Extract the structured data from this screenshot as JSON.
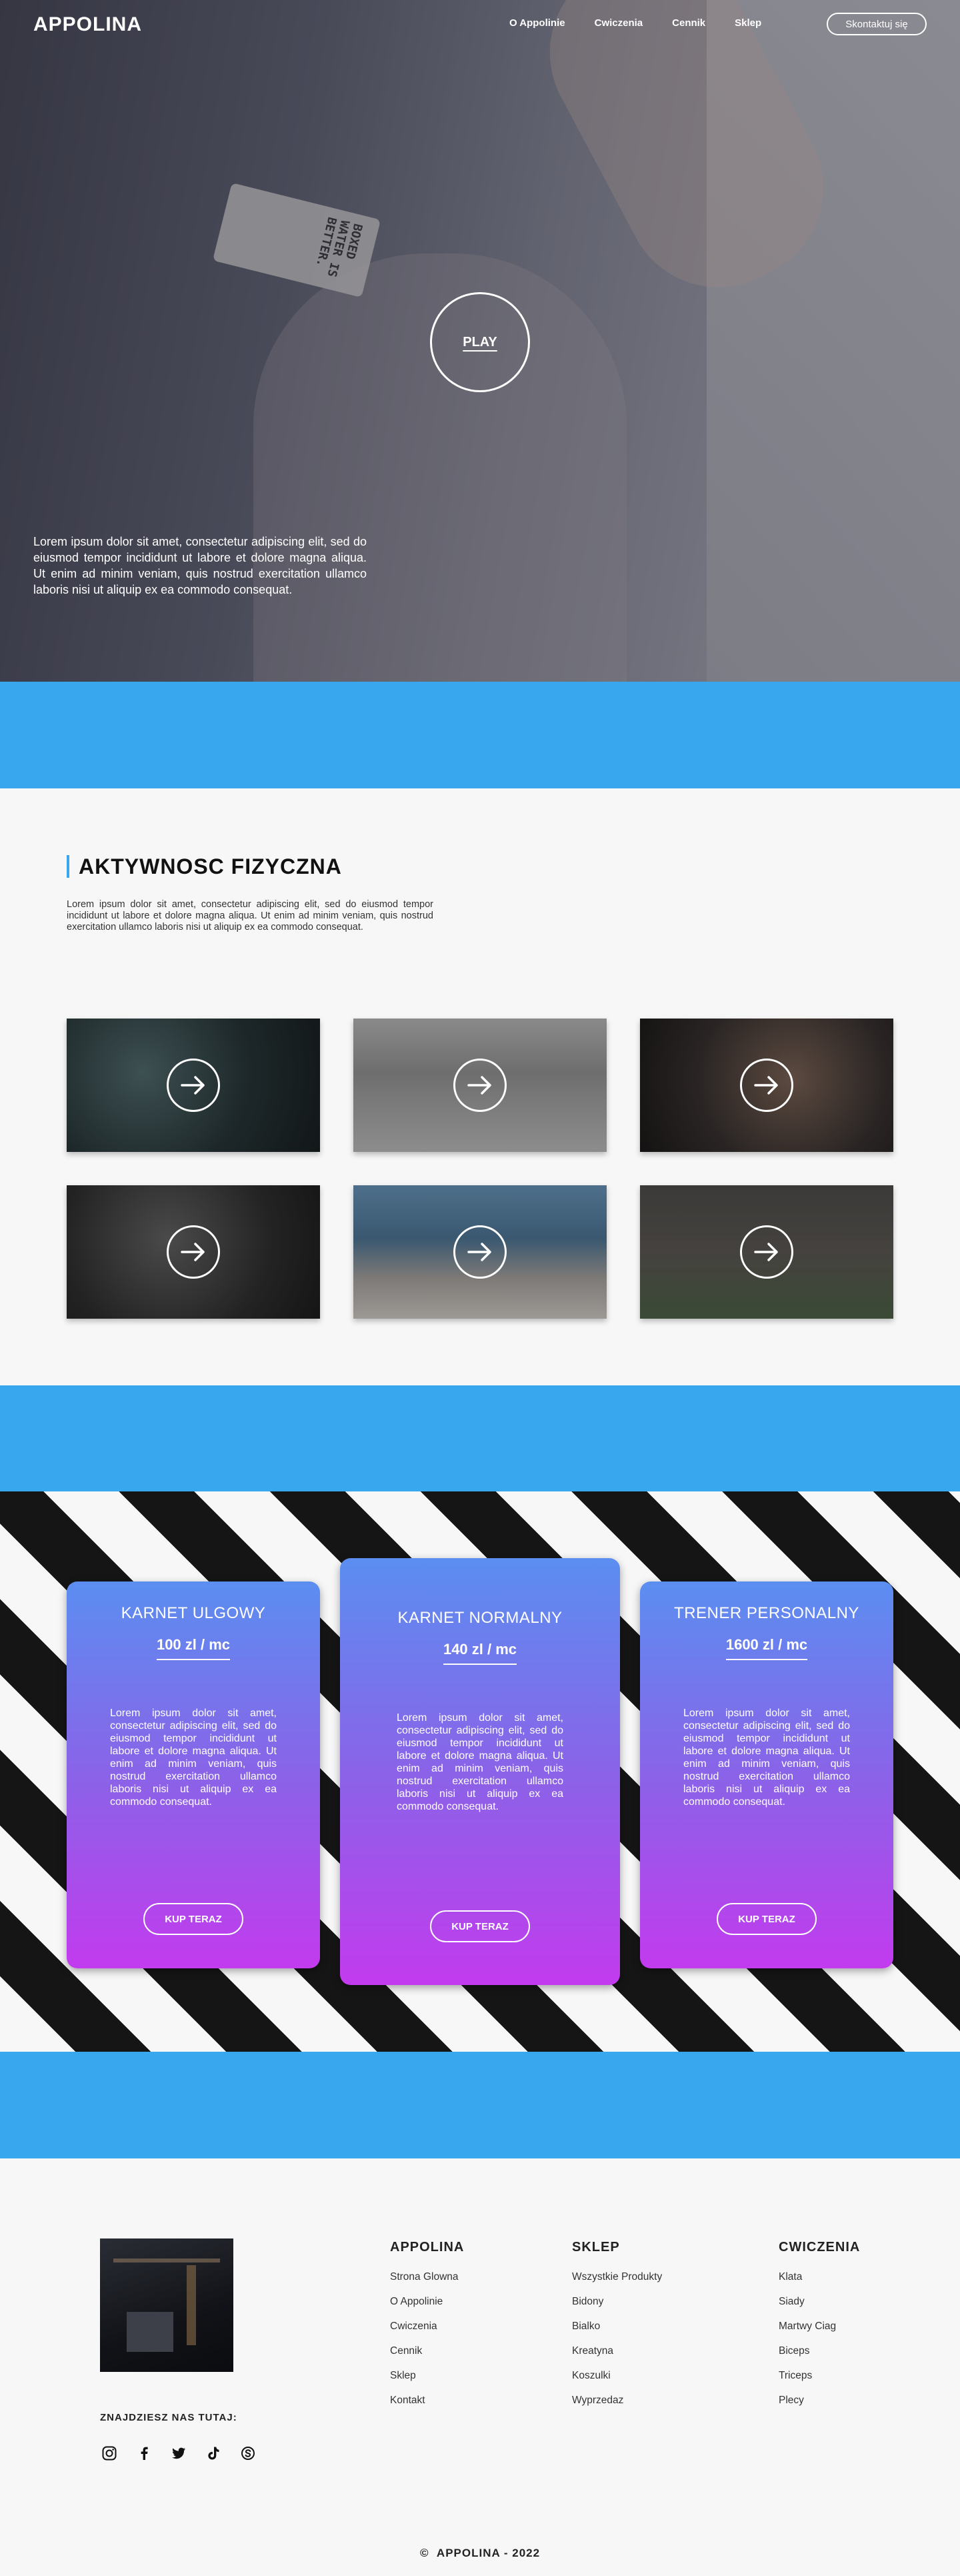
{
  "header": {
    "logo": "APPOLINA",
    "nav": [
      "O Appolinie",
      "Cwiczenia",
      "Cennik",
      "Sklep"
    ],
    "contact_label": "Skontaktuj się"
  },
  "hero": {
    "carton_text": "BOXED WATER IS BETTER.",
    "play_label": "PLAY",
    "text": "Lorem ipsum dolor sit amet, consectetur adipiscing elit, sed do eiusmod tempor incididunt ut labore et dolore magna aliqua. Ut enim ad minim veniam, quis nostrud exercitation ullamco laboris nisi ut aliquip ex ea commodo consequat."
  },
  "activity": {
    "title": "AKTYWNOSC FIZYCZNA",
    "text": "Lorem ipsum dolor sit amet, consectetur adipiscing elit, sed do eiusmod tempor incididunt ut labore et dolore magna aliqua. Ut enim ad minim veniam, quis nostrud exercitation ullamco laboris nisi ut aliquip ex ea commodo consequat.",
    "tiles": [
      {
        "icon": "arrow-right-icon"
      },
      {
        "icon": "arrow-right-icon"
      },
      {
        "icon": "arrow-right-icon"
      },
      {
        "icon": "arrow-right-icon"
      },
      {
        "icon": "arrow-right-icon"
      },
      {
        "icon": "arrow-right-icon"
      }
    ]
  },
  "pricing": {
    "cards": [
      {
        "title": "KARNET ULGOWY",
        "price": "100 zl / mc",
        "text": "Lorem ipsum dolor sit amet, consectetur adipiscing elit, sed do eiusmod tempor incididunt ut labore et dolore magna aliqua. Ut enim ad minim veniam, quis nostrud exercitation ullamco laboris nisi ut aliquip ex ea commodo consequat.",
        "button": "KUP TERAZ"
      },
      {
        "title": "KARNET NORMALNY",
        "price": "140 zl / mc",
        "text": "Lorem ipsum dolor sit amet, consectetur adipiscing elit, sed do eiusmod tempor incididunt ut labore et dolore magna aliqua. Ut enim ad minim veniam, quis nostrud exercitation ullamco laboris nisi ut aliquip ex ea commodo consequat.",
        "button": "KUP TERAZ"
      },
      {
        "title": "TRENER PERSONALNY",
        "price": "1600 zl / mc",
        "text": "Lorem ipsum dolor sit amet, consectetur adipiscing elit, sed do eiusmod tempor incididunt ut labore et dolore magna aliqua. Ut enim ad minim veniam, quis nostrud exercitation ullamco laboris nisi ut aliquip ex ea commodo consequat.",
        "button": "KUP TERAZ"
      }
    ]
  },
  "footer": {
    "find_us": "ZNAJDZIESZ NAS TUTAJ:",
    "socials": [
      "instagram-icon",
      "facebook-icon",
      "twitter-icon",
      "tiktok-icon",
      "skype-icon"
    ],
    "columns": [
      {
        "title": "APPOLINA",
        "links": [
          "Strona Glowna",
          "O Appolinie",
          "Cwiczenia",
          "Cennik",
          "Sklep",
          "Kontakt"
        ]
      },
      {
        "title": "SKLEP",
        "links": [
          "Wszystkie Produkty",
          "Bidony",
          "Bialko",
          "Kreatyna",
          "Koszulki",
          "Wyprzedaz"
        ]
      },
      {
        "title": "CWICZENIA",
        "links": [
          "Klata",
          "Siady",
          "Martwy Ciag",
          "Biceps",
          "Triceps",
          "Plecy"
        ]
      }
    ],
    "copyright": "APPOLINA - 2022"
  },
  "colors": {
    "accent_blue": "#38a7ee",
    "card_top": "#5b8ef0",
    "card_bottom": "#c23bee"
  }
}
